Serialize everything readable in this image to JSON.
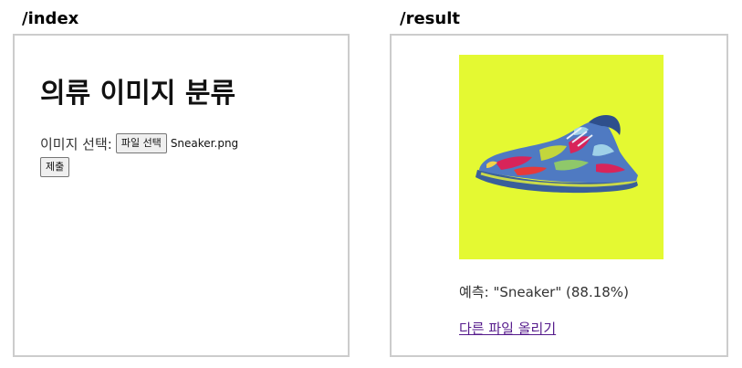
{
  "index_panel": {
    "route_label": "/index",
    "heading": "의류 이미지 분류",
    "file_label": "이미지 선택:",
    "file_button": "파일 선택",
    "file_name": "Sneaker.png",
    "submit_button": "제출"
  },
  "result_panel": {
    "route_label": "/result",
    "image_background": "#e4f932",
    "prediction_prefix": "예측:",
    "prediction_class": "\"Sneaker\"",
    "prediction_confidence": "(88.18%)",
    "upload_another_link": "다른 파일 올리기"
  }
}
